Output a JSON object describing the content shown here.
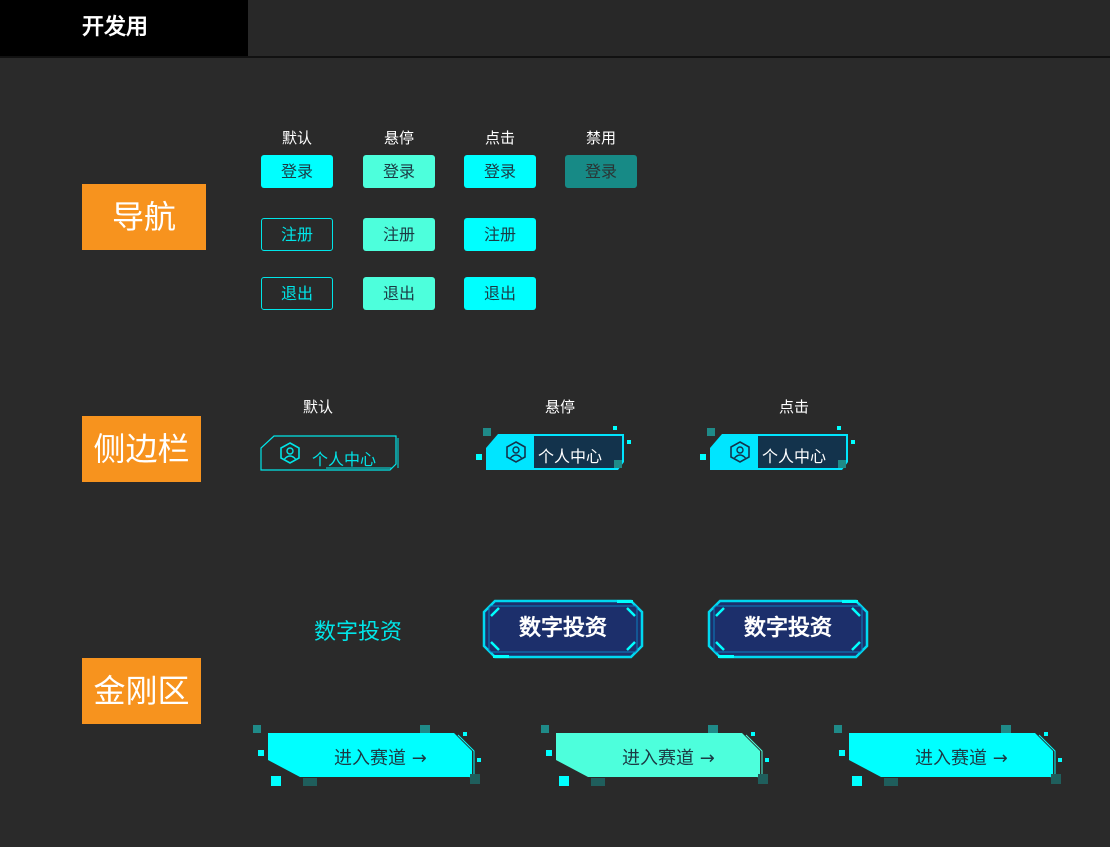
{
  "header": {
    "tab_label": "开发用"
  },
  "sections": {
    "nav": "导航",
    "sidebar": "侧边栏",
    "kingkong": "金刚区"
  },
  "states": {
    "default": "默认",
    "hover": "悬停",
    "click": "点击",
    "disabled": "禁用"
  },
  "nav_buttons": {
    "login": "登录",
    "register": "注册",
    "logout": "退出"
  },
  "sidebar_item": {
    "label": "个人中心",
    "icon": "user-hexagon-icon"
  },
  "kingkong": {
    "label": "数字投资"
  },
  "enter_race": {
    "label": "进入赛道",
    "arrow": "→"
  },
  "colors": {
    "accent": "#00ffff",
    "hover": "#4dffdc",
    "disabled": "#178a86",
    "tag": "#f7931e",
    "badge_bg": "#1c2f6b"
  }
}
